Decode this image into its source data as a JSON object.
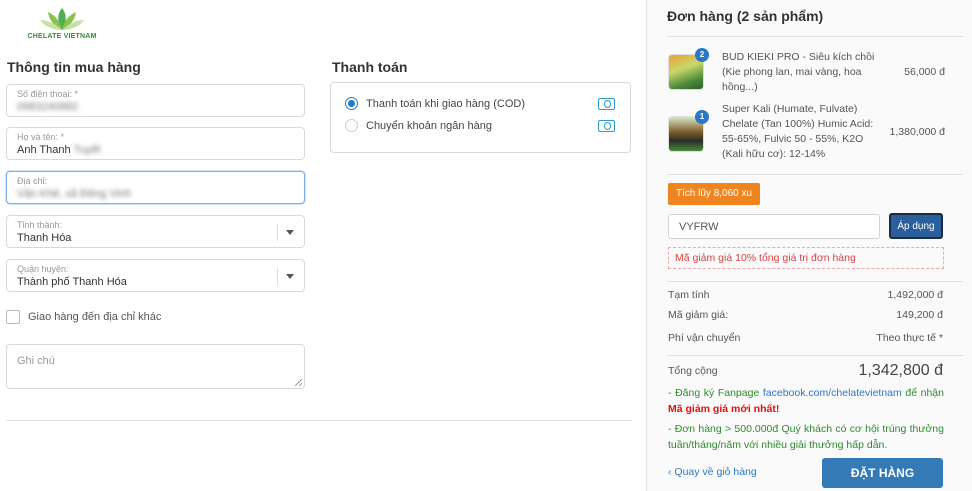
{
  "brand": {
    "logo_text": "CHELATE VIETNAM"
  },
  "customer": {
    "title": "Thông tin mua hàng",
    "phone": {
      "label": "Số điện thoại: *",
      "value": "0983240882"
    },
    "name": {
      "label": "Họ và tên: *",
      "value_first": "Anh Thanh",
      "value_last": "Tuyết"
    },
    "address": {
      "label": "Địa chỉ:",
      "value": "Vân Khê, xã Đông Vinh"
    },
    "province": {
      "label": "Tỉnh thành:",
      "value": "Thanh Hóa"
    },
    "district": {
      "label": "Quận huyện:",
      "value": "Thành phố Thanh Hóa"
    },
    "ship_other_label": "Giao hàng đến địa chỉ khác",
    "note_placeholder": "Ghi chú"
  },
  "payment": {
    "title": "Thanh toán",
    "options": [
      {
        "label": "Thanh toán khi giao hàng (COD)",
        "selected": true,
        "icon": "money-icon"
      },
      {
        "label": "Chuyển khoản ngân hàng",
        "selected": false,
        "icon": "money-icon"
      }
    ]
  },
  "order": {
    "title": "Đơn hàng (2 sản phẩm)",
    "items": [
      {
        "qty": "2",
        "name": "BUD KIEKI PRO - Siêu kích chồi (Kie phong lan, mai vàng, hoa hồng...)",
        "price": "56,000 đ"
      },
      {
        "qty": "1",
        "name": "Super Kali (Humate, Fulvate) Chelate (Tan 100%) Humic Acid: 55-65%, Fulvic 50 - 55%, K2O (Kali hữu cơ): 12-14%",
        "price": "1,380,000 đ"
      }
    ],
    "points_badge": "Tích lũy 8,060 xu",
    "coupon_value": "VYFRW",
    "apply_label": "Áp dụng",
    "coupon_message": "Mã giảm giá 10% tổng giá trị đơn hàng",
    "subtotal_label": "Tạm tính",
    "subtotal_value": "1,492,000 đ",
    "discount_label": "Mã giảm giá:",
    "discount_value": "149,200 đ",
    "shipping_label": "Phí vận chuyển",
    "shipping_value": "Theo thực tế *",
    "total_label": "Tổng cộng",
    "total_value": "1,342,800 đ",
    "note1_prefix": "- Đăng ký Fanpage",
    "note1_link": "facebook.com/chelatevietnam",
    "note1_mid": "để nhận",
    "note1_red": "Mã giảm giá mới nhất!",
    "note2": "- Đơn hàng > 500.000đ Quý khách có cơ hội trúng thưởng tuần/tháng/năm với nhiều giải thưởng hấp dẫn.",
    "back_label": "Quay về giỏ hàng",
    "submit_label": "ĐẶT HÀNG"
  },
  "colors": {
    "primary": "#337ab7",
    "accent": "#f0841e",
    "success": "#2e8b2e",
    "danger": "#e01010"
  }
}
